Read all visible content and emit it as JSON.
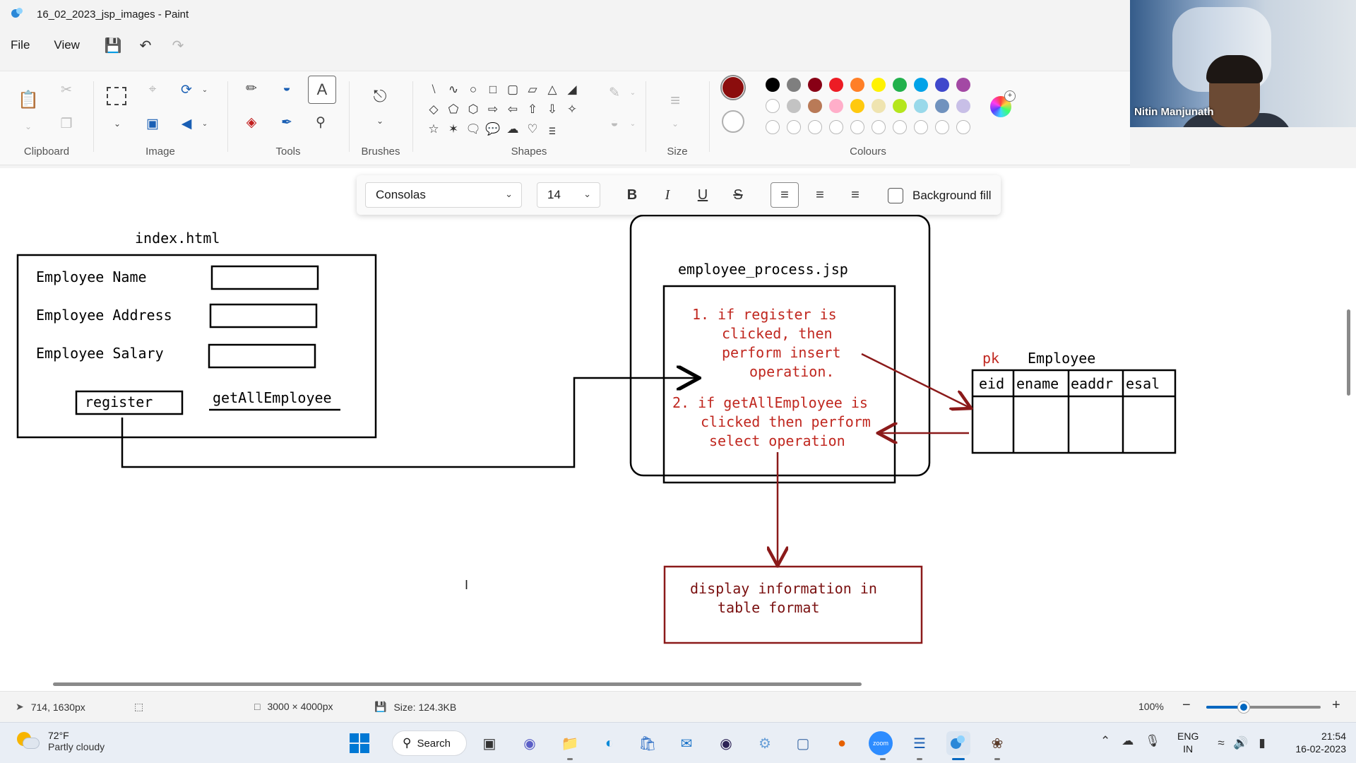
{
  "window": {
    "title": "16_02_2023_jsp_images - Paint"
  },
  "menu": {
    "file": "File",
    "view": "View",
    "save_icon": "save-icon",
    "undo_icon": "undo-icon",
    "redo_icon": "redo-icon"
  },
  "ribbon": {
    "groups": {
      "clipboard": "Clipboard",
      "image": "Image",
      "tools": "Tools",
      "brushes": "Brushes",
      "shapes": "Shapes",
      "size": "Size",
      "colours": "Colours"
    },
    "colour1": "#8b0d0d",
    "palette_row1": [
      "#000000",
      "#7f7f7f",
      "#880015",
      "#ed1c24",
      "#ff7f27",
      "#fff200",
      "#22b14c",
      "#00a2e8",
      "#3f48cc",
      "#a349a4"
    ],
    "palette_row2": [
      "#ffffff",
      "#c3c3c3",
      "#b97a57",
      "#ffaec9",
      "#ffc90e",
      "#efe4b0",
      "#b5e61d",
      "#99d9ea",
      "#7092be",
      "#c8bfe7"
    ]
  },
  "webcam": {
    "name": "Nitin Manjunath"
  },
  "text_toolbar": {
    "font": "Consolas",
    "size": "14",
    "bold": "B",
    "italic": "I",
    "underline": "U",
    "strike": "S",
    "background_fill": "Background fill"
  },
  "diagram": {
    "index_title": "index.html",
    "form_labels": [
      "Employee Name",
      "Employee Address",
      "Employee Salary"
    ],
    "register_button": "register",
    "get_all_link": "getAllEmployee",
    "jsp_title": "employee_process.jsp",
    "step1_lines": [
      "1. if register is",
      "clicked, then",
      "perform insert",
      "operation."
    ],
    "step2_lines": [
      "2. if getAllEmployee is",
      "clicked then perform",
      "select operation"
    ],
    "pk_label": "pk",
    "table_title": "Employee",
    "table_columns": [
      "eid",
      "ename",
      "eaddr",
      "esal"
    ],
    "display_lines": [
      "display information in",
      "table format"
    ]
  },
  "statusbar": {
    "cursor_pos": "714, 1630px",
    "canvas_size": "3000 × 4000px",
    "file_size": "Size: 124.3KB",
    "zoom": "100%",
    "zoom_fraction": 0.33
  },
  "taskbar": {
    "weather_temp": "72°F",
    "weather_desc": "Partly cloudy",
    "search": "Search",
    "lang_line1": "ENG",
    "lang_line2": "IN",
    "time": "21:54",
    "date": "16-02-2023"
  }
}
